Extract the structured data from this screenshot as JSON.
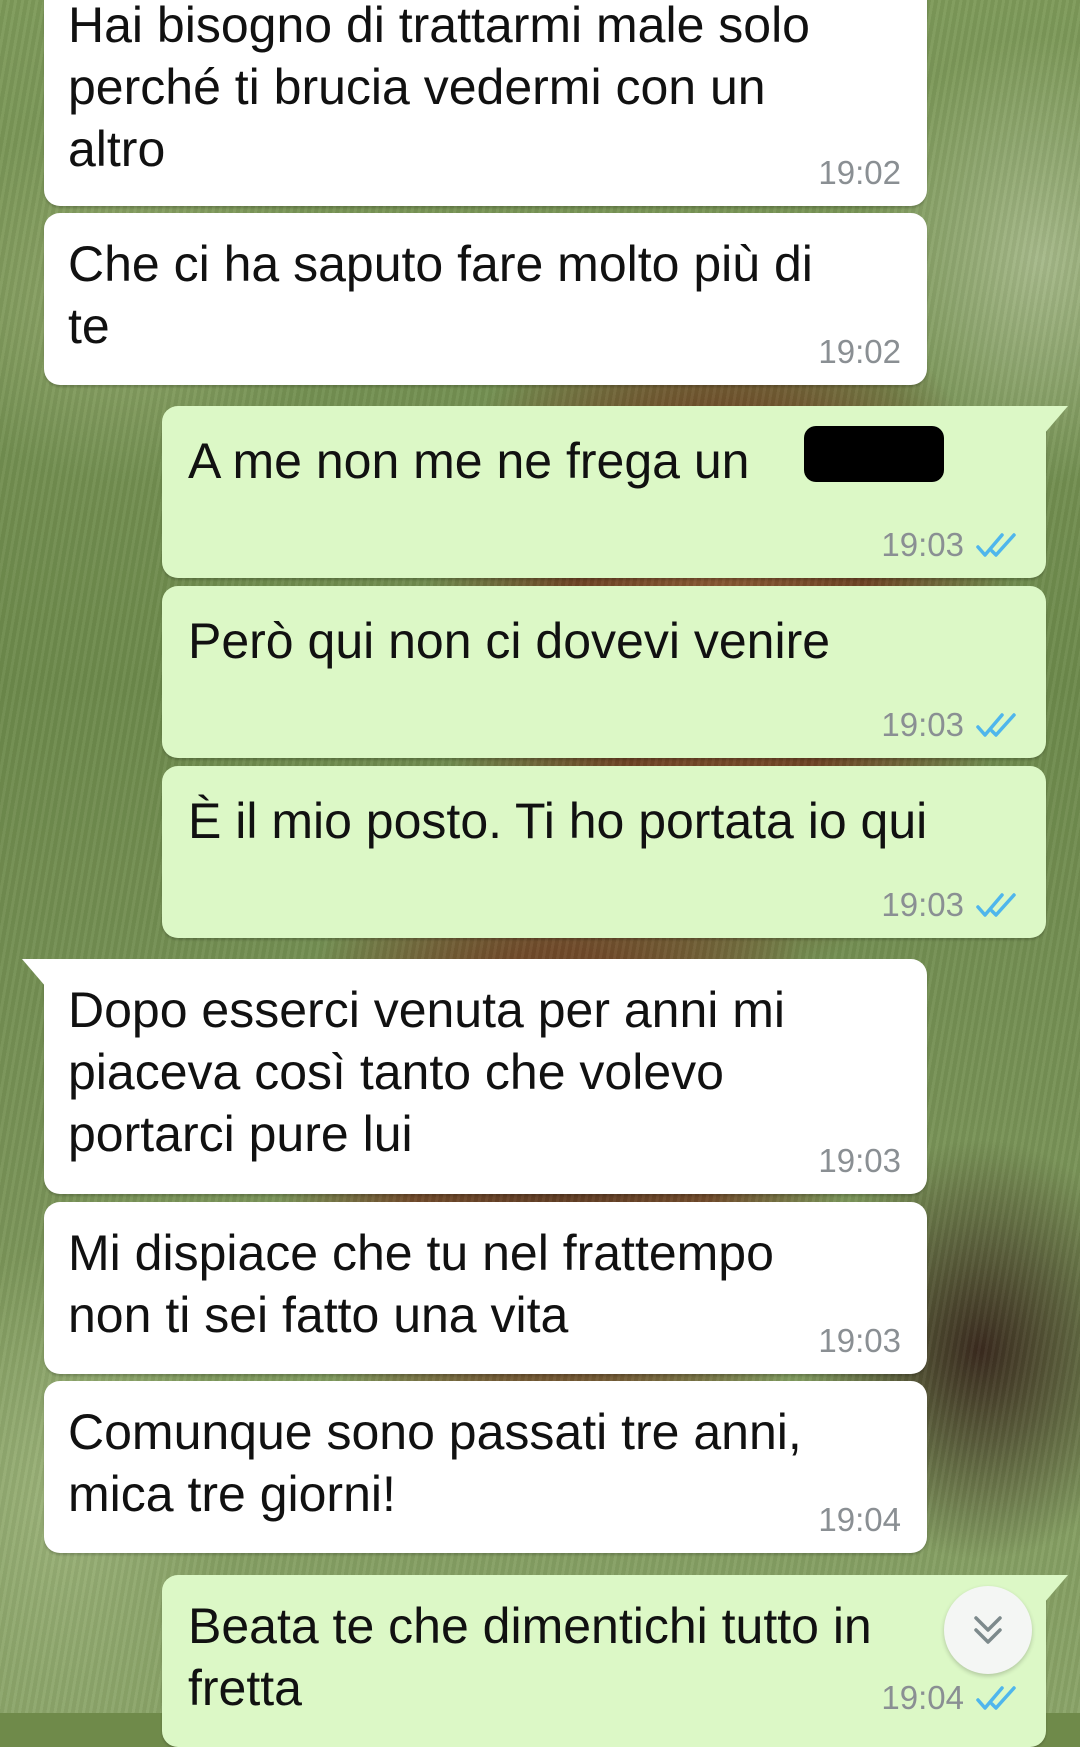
{
  "colors": {
    "incoming_bubble": "#ffffff",
    "outgoing_bubble": "#dcf8c6",
    "read_checks": "#4fb6ec",
    "timestamp": "#8a8f93"
  },
  "messages": [
    {
      "direction": "in",
      "text": "Hai bisogno di trattarmi male solo\nperché ti brucia vedermi con un\naltro",
      "time": "19:02"
    },
    {
      "direction": "in",
      "text": "Che ci ha saputo fare molto più di\nte",
      "time": "19:02"
    },
    {
      "direction": "out",
      "text": "A me non me ne frega un",
      "time": "19:03",
      "status_icon": "double-check-read-icon",
      "redacted": true
    },
    {
      "direction": "out",
      "text": "Però qui non ci dovevi venire",
      "time": "19:03",
      "status_icon": "double-check-read-icon"
    },
    {
      "direction": "out",
      "text": "È il mio posto. Ti ho portata io qui",
      "time": "19:03",
      "status_icon": "double-check-read-icon"
    },
    {
      "direction": "in",
      "text": "Dopo esserci venuta per anni mi\npiaceva così tanto che volevo\nportarci pure lui",
      "time": "19:03"
    },
    {
      "direction": "in",
      "text": "Mi dispiace che tu nel frattempo\nnon ti sei fatto una vita",
      "time": "19:03"
    },
    {
      "direction": "in",
      "text": "Comunque sono passati tre anni,\nmica tre giorni!",
      "time": "19:04"
    },
    {
      "direction": "out",
      "text": "Beata te che dimentichi tutto in\nfretta",
      "time": "19:04",
      "status_icon": "double-check-read-icon"
    }
  ],
  "scroll_button": {
    "icon": "chevron-double-down-icon"
  }
}
